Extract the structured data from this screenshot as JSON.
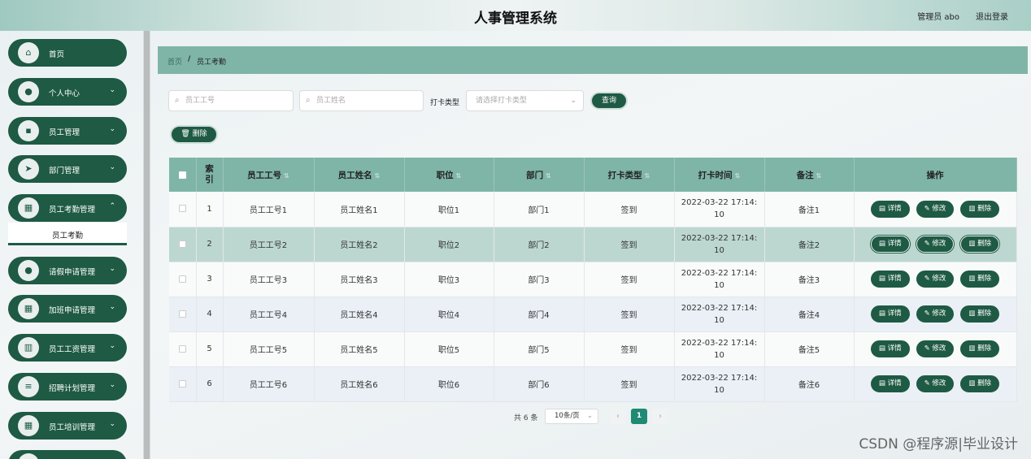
{
  "header": {
    "title": "人事管理系统",
    "user": "管理员 abo",
    "logout": "退出登录"
  },
  "sidebar": {
    "items": [
      {
        "label": "首页",
        "icon": "home-icon",
        "glyph": "⌂",
        "has_chevron": false
      },
      {
        "label": "个人中心",
        "icon": "user-icon",
        "glyph": "●",
        "has_chevron": true
      },
      {
        "label": "员工管理",
        "icon": "briefcase-icon",
        "glyph": "▪",
        "has_chevron": true
      },
      {
        "label": "部门管理",
        "icon": "send-icon",
        "glyph": "➤",
        "has_chevron": true
      },
      {
        "label": "员工考勤管理",
        "icon": "grid-icon",
        "glyph": "▦",
        "has_chevron": true
      },
      {
        "label": "请假申请管理",
        "icon": "person-icon",
        "glyph": "●",
        "has_chevron": true
      },
      {
        "label": "加班申请管理",
        "icon": "grid-icon",
        "glyph": "▦",
        "has_chevron": true
      },
      {
        "label": "员工工资管理",
        "icon": "bar-chart-icon",
        "glyph": "▥",
        "has_chevron": true
      },
      {
        "label": "招聘计划管理",
        "icon": "list-icon",
        "glyph": "≡",
        "has_chevron": true
      },
      {
        "label": "员工培训管理",
        "icon": "grid-icon",
        "glyph": "▦",
        "has_chevron": true
      }
    ],
    "submenu_active": "员工考勤"
  },
  "breadcrumb": {
    "home": "首页",
    "separator": "/",
    "current": "员工考勤"
  },
  "filters": {
    "employee_no_placeholder": "员工工号",
    "employee_name_placeholder": "员工姓名",
    "punch_type_label": "打卡类型",
    "punch_type_placeholder": "请选择打卡类型",
    "query_button": "查询"
  },
  "toolbar": {
    "delete_button": "删除"
  },
  "table": {
    "columns": [
      "索引",
      "员工工号",
      "员工姓名",
      "职位",
      "部门",
      "打卡类型",
      "打卡时间",
      "备注",
      "操作"
    ],
    "rows": [
      {
        "index": "1",
        "emp_no": "员工工号1",
        "name": "员工姓名1",
        "position": "职位1",
        "dept": "部门1",
        "punch_type": "签到",
        "time_a": "2022-03-22 17:14:",
        "time_b": "10",
        "remark": "备注1"
      },
      {
        "index": "2",
        "emp_no": "员工工号2",
        "name": "员工姓名2",
        "position": "职位2",
        "dept": "部门2",
        "punch_type": "签到",
        "time_a": "2022-03-22 17:14:",
        "time_b": "10",
        "remark": "备注2"
      },
      {
        "index": "3",
        "emp_no": "员工工号3",
        "name": "员工姓名3",
        "position": "职位3",
        "dept": "部门3",
        "punch_type": "签到",
        "time_a": "2022-03-22 17:14:",
        "time_b": "10",
        "remark": "备注3"
      },
      {
        "index": "4",
        "emp_no": "员工工号4",
        "name": "员工姓名4",
        "position": "职位4",
        "dept": "部门4",
        "punch_type": "签到",
        "time_a": "2022-03-22 17:14:",
        "time_b": "10",
        "remark": "备注4"
      },
      {
        "index": "5",
        "emp_no": "员工工号5",
        "name": "员工姓名5",
        "position": "职位5",
        "dept": "部门5",
        "punch_type": "签到",
        "time_a": "2022-03-22 17:14:",
        "time_b": "10",
        "remark": "备注5"
      },
      {
        "index": "6",
        "emp_no": "员工工号6",
        "name": "员工姓名6",
        "position": "职位6",
        "dept": "部门6",
        "punch_type": "签到",
        "time_a": "2022-03-22 17:14:",
        "time_b": "10",
        "remark": "备注6"
      }
    ],
    "actions": {
      "detail": "详情",
      "edit": "修改",
      "delete": "删除"
    }
  },
  "pagination": {
    "total": "共 6 条",
    "page_size": "10条/页",
    "current_page": "1",
    "prev": "‹",
    "next": "›"
  },
  "watermark": "CSDN @程序源|毕业设计",
  "colors": {
    "primary": "#1e5a44",
    "header_teal": "#7fb5a7",
    "active_page": "#1f8a73"
  }
}
